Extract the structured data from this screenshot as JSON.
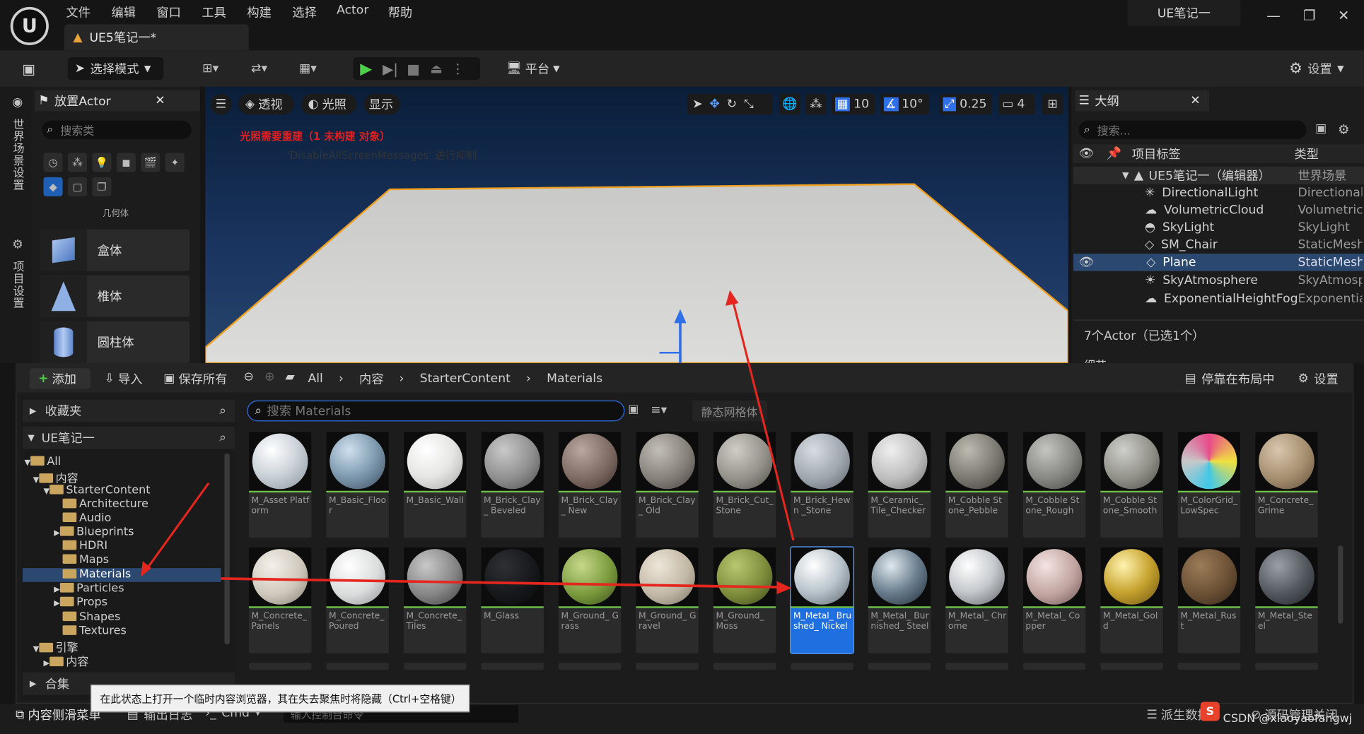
{
  "menu": [
    "文件",
    "编辑",
    "窗口",
    "工具",
    "构建",
    "选择",
    "Actor",
    "帮助"
  ],
  "tab_title": "UE5笔记一*",
  "app_title": "UE笔记一",
  "toolbar": {
    "mode": "选择模式",
    "platform": "平台",
    "settings": "设置"
  },
  "left_strip": {
    "world": "世界场景设置",
    "project": "项目设置"
  },
  "place": {
    "title": "放置Actor",
    "search": "搜索类",
    "category": "几何体",
    "shapes": [
      "盒体",
      "椎体",
      "圆柱体"
    ]
  },
  "viewport": {
    "perspective": "透视",
    "lighting": "光照",
    "show": "显示",
    "grid": "10",
    "angle": "10°",
    "scale": "0.25",
    "camspeed": "4",
    "warn1": "光照需要重建（1 未构建 对象）",
    "warn2": "'DisableAllScreenMessages' 进行抑制"
  },
  "outliner": {
    "title": "大纲",
    "search": "搜索...",
    "col_label": "项目标签",
    "col_type": "类型",
    "count": "7个Actor（已选1个）",
    "details": "细节",
    "root": {
      "name": "UE5笔记一（编辑器）",
      "type": "世界场景"
    },
    "items": [
      {
        "name": "DirectionalLight",
        "type": "DirectionalL"
      },
      {
        "name": "VolumetricCloud",
        "type": "Volumetric("
      },
      {
        "name": "SkyLight",
        "type": "SkyLight"
      },
      {
        "name": "SM_Chair",
        "type": "StaticMesh."
      },
      {
        "name": "Plane",
        "type": "StaticMesh."
      },
      {
        "name": "SkyAtmosphere",
        "type": "SkyAtmosp"
      },
      {
        "name": "ExponentialHeightFog",
        "type": "Exponential"
      }
    ]
  },
  "cb": {
    "add": "添加",
    "import": "导入",
    "saveall": "保存所有",
    "crumbs": [
      "All",
      "内容",
      "StarterContent",
      "Materials"
    ],
    "dock": "停靠在布局中",
    "settings": "设置",
    "favorites": "收藏夹",
    "project": "UE笔记一",
    "search": "搜索 Materials",
    "filter": "静态网格体",
    "collections": "合集",
    "tree": [
      "All",
      "内容",
      "StarterContent",
      "Architecture",
      "Audio",
      "Blueprints",
      "HDRI",
      "Maps",
      "Materials",
      "Particles",
      "Props",
      "Shapes",
      "Textures",
      "引擎",
      "内容"
    ],
    "assets": [
      [
        "M_Asset Platform",
        "M_Basic_Floor",
        "M_Basic_Wall",
        "M_Brick_Clay_ Beveled",
        "M_Brick_Clay_ New",
        "M_Brick_Clay_ Old",
        "M_Brick_Cut_ Stone",
        "M_Brick_Hewn _Stone",
        "M_Ceramic_ Tile_Checker",
        "M_Cobble Stone_Pebble",
        "M_Cobble Stone_Rough",
        "M_Cobble Stone_Smooth",
        "M_ColorGrid_ LowSpec",
        "M_Concrete_ Grime"
      ],
      [
        "M_Concrete_ Panels",
        "M_Concrete_ Poured",
        "M_Concrete_ Tiles",
        "M_Glass",
        "M_Ground_ Grass",
        "M_Ground_ Gravel",
        "M_Ground_ Moss",
        "M_Metal_ Brushed_ Nickel",
        "M_Metal_ Burnished_ Steel",
        "M_Metal_ Chrome",
        "M_Metal_ Copper",
        "M_Metal_Gold",
        "M_Metal_Rust",
        "M_Metal_Steel"
      ]
    ]
  },
  "status": {
    "drawer": "内容侧滑菜单",
    "log": "输出日志",
    "cmd": "Cmd",
    "cmdph": "输入控制台命令",
    "derived": "派生数据",
    "source": "源码管理关闭",
    "watermark": "CSDN @xiaoyaofangwj"
  },
  "tooltip": "在此状态上打开一个临时内容浏览器，其在失去聚焦时将隐藏（Ctrl+空格键）"
}
